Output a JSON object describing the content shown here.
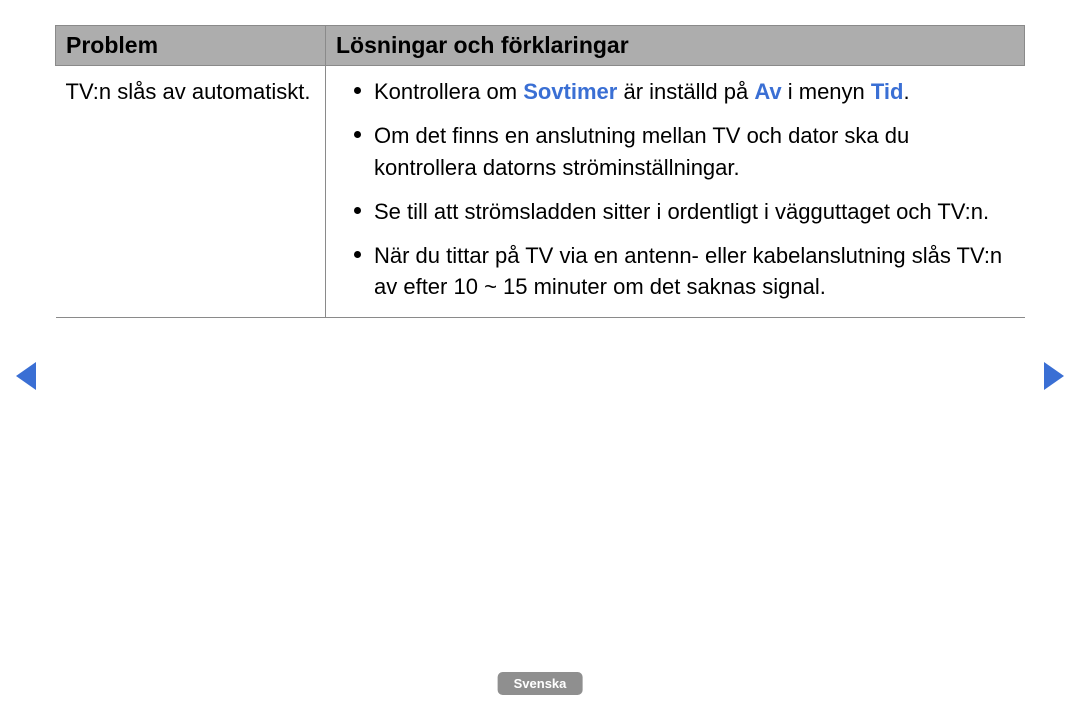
{
  "table": {
    "header_problem": "Problem",
    "header_solutions": "Lösningar och förklaringar",
    "row": {
      "problem": "TV:n slås av automatiskt.",
      "bullets": [
        {
          "pre": "Kontrollera om ",
          "hl1": "Sovtimer",
          "mid": " är inställd på ",
          "hl2": "Av",
          "mid2": " i menyn ",
          "hl3": "Tid",
          "post": "."
        },
        {
          "text": "Om det finns en anslutning mellan TV och dator ska du kontrollera datorns ströminställningar."
        },
        {
          "text": "Se till att strömsladden sitter i ordentligt i vägguttaget och TV:n."
        },
        {
          "text": "När du tittar på TV via en antenn- eller kabelanslutning slås TV:n av efter 10 ~ 15 minuter om det saknas signal."
        }
      ]
    }
  },
  "footer": {
    "language": "Svenska"
  }
}
